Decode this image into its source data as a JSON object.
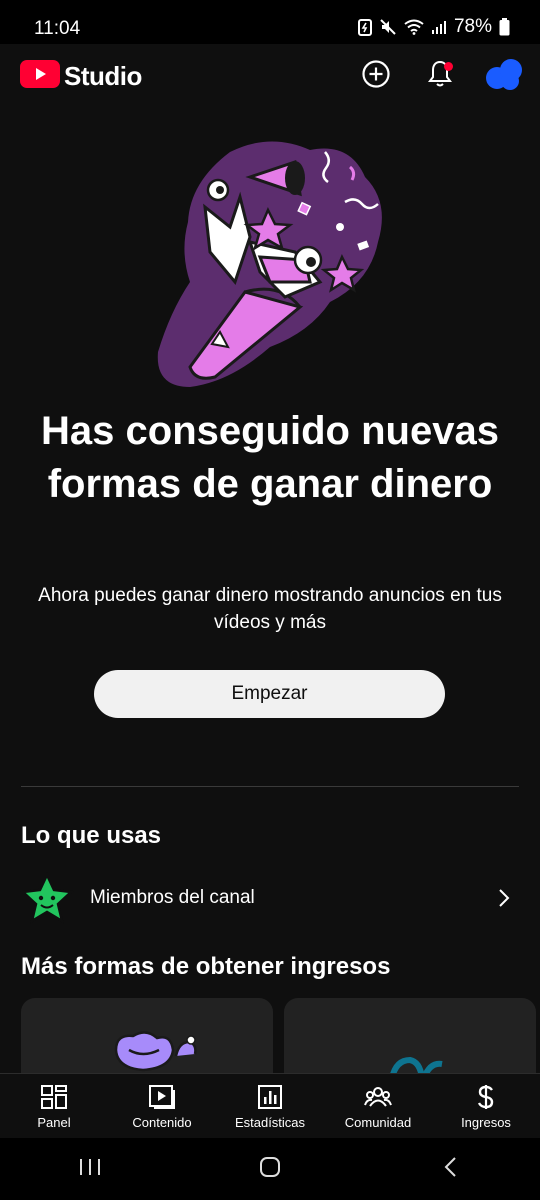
{
  "status_bar": {
    "time": "11:04",
    "battery": "78%"
  },
  "header": {
    "logo_text": "Studio",
    "brand_color": "#ff0033",
    "actions": [
      "create-icon",
      "notifications-icon",
      "avatar"
    ]
  },
  "hero": {
    "title": "Has conseguido nuevas formas de ganar dinero",
    "subtitle": "Ahora puedes ganar dinero mostrando anuncios en tus vídeos y más",
    "cta_label": "Empezar"
  },
  "using": {
    "title": "Lo que usas",
    "items": [
      {
        "icon": "star-membership-icon",
        "label": "Miembros del canal"
      }
    ]
  },
  "more": {
    "title": "Más formas de obtener ingresos"
  },
  "bottom_nav": [
    {
      "icon": "dashboard-icon",
      "label": "Panel"
    },
    {
      "icon": "content-icon",
      "label": "Contenido"
    },
    {
      "icon": "analytics-icon",
      "label": "Estadísticas"
    },
    {
      "icon": "community-icon",
      "label": "Comunidad"
    },
    {
      "icon": "earn-icon",
      "label": "Ingresos"
    }
  ]
}
